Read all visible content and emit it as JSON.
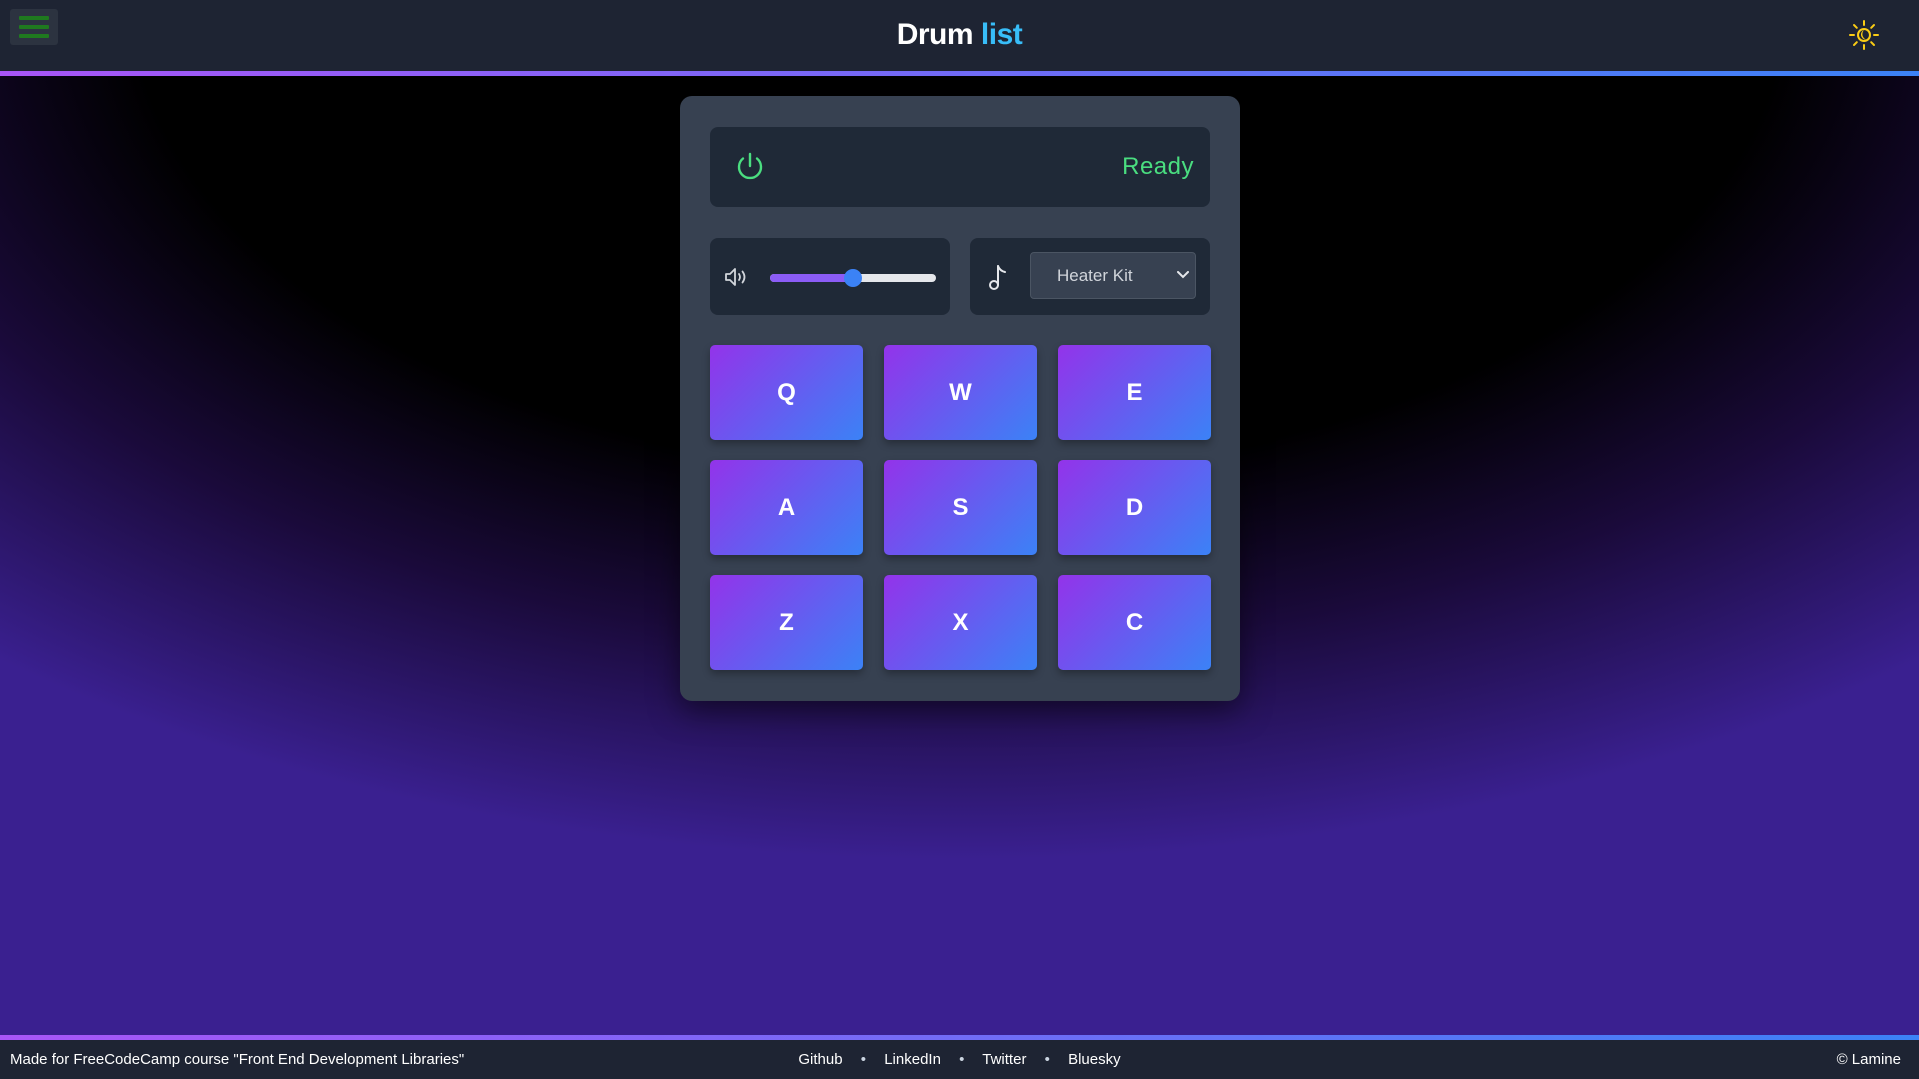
{
  "header": {
    "title_main": "Drum",
    "title_accent": "list"
  },
  "display": {
    "status": "Ready"
  },
  "volume": {
    "level_fraction": 0.5
  },
  "kit_select": {
    "selected": "Heater Kit"
  },
  "pads": [
    {
      "key": "Q"
    },
    {
      "key": "W"
    },
    {
      "key": "E"
    },
    {
      "key": "A"
    },
    {
      "key": "S"
    },
    {
      "key": "D"
    },
    {
      "key": "Z"
    },
    {
      "key": "X"
    },
    {
      "key": "C"
    }
  ],
  "footer": {
    "made_for": "Made for FreeCodeCamp course \"Front End Development Libraries\"",
    "links": [
      "Github",
      "LinkedIn",
      "Twitter",
      "Bluesky"
    ],
    "separator": "•",
    "copyright": "© Lamine"
  },
  "colors": {
    "accent_blue": "#38bdf8",
    "status_green": "#4ade80",
    "pad_gradient_start": "#9333ea",
    "pad_gradient_end": "#3b82f6",
    "sun_icon": "#facc15"
  },
  "icons": {
    "menu": "hamburger-menu-icon",
    "theme": "sun-icon",
    "power": "power-icon",
    "volume": "speaker-volume-icon",
    "kit": "music-note-icon",
    "dropdown": "chevron-down-icon"
  }
}
